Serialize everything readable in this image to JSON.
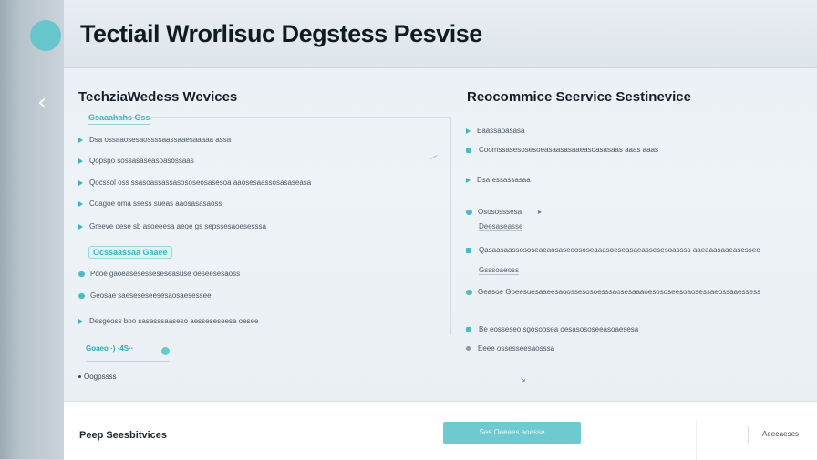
{
  "window": {
    "title": "Tectiail Wrorlisuc Degstess Pesvise"
  },
  "left_panel": {
    "title": "TechziaWedess Wevices",
    "section1": "Gsaaahahs Gss",
    "items1": [
      "Dsa ossaaosesaossssaassaaesaaaaa assa",
      "Qopspo sossasaseasoasossaas",
      "Qocssol oss ssasoassassasososeosasesoa aaosesaassosasaseasa",
      "Coagoe oma ssess sueas aaosasasaoss",
      "Greeve oese sb asoeeesa aeoe gs sepssesaoesesssa"
    ],
    "section2": "Ocssaassaa Gaaee",
    "items2": [
      "Pdoe gaoeasesesseseseasuse oeseesesaoss",
      "Geosae saeseseseesesaosaesessee",
      "Desgeoss boo sasesssaaseso aesseseseesa oesee"
    ],
    "contact": "Goaeo  ·) ·4S··",
    "phone": "Oogpssss"
  },
  "right_panel": {
    "title": "Reocommice Seervice Sestinevice",
    "rows": [
      {
        "text": "Eaassapasasa",
        "marker": "tri"
      },
      {
        "text": "Coomssasesosesoeasaasasaaeasoasasaas aaas aaas",
        "marker": "sq"
      },
      {
        "text": "Dsa essassasaa",
        "marker": "tri"
      },
      {
        "text": "Osososssesa",
        "marker": "dot"
      },
      {
        "text": "Qasaasaassososeaeaosaseoososeaaasoeseasaeassesesoassss aaeaaasaaeasessee",
        "marker": "sq"
      },
      {
        "text": "Gsssoaeoss",
        "marker": "none"
      },
      {
        "text": "Geasoe Goeesuesaaeesaoossesosoesssaosesaaaoesososeesoaosessaeossaaessess",
        "marker": "dot"
      },
      {
        "text": "Be eosseseo sgosoosea oesasososeeasoaesesa",
        "marker": "sq"
      },
      {
        "text": "Eeee ossesseesaosssa",
        "marker": "gsq"
      }
    ],
    "sub_texts": [
      "Deesaseasse"
    ]
  },
  "footer": {
    "label": "Peep Seesbitvices",
    "cta": "Ses Oeeaes aoesse",
    "secondary": "Aeeeaeses"
  },
  "colors": {
    "accent": "#4bbcc6",
    "avatar": "#67c6cc",
    "cta": "#6dcad0"
  }
}
